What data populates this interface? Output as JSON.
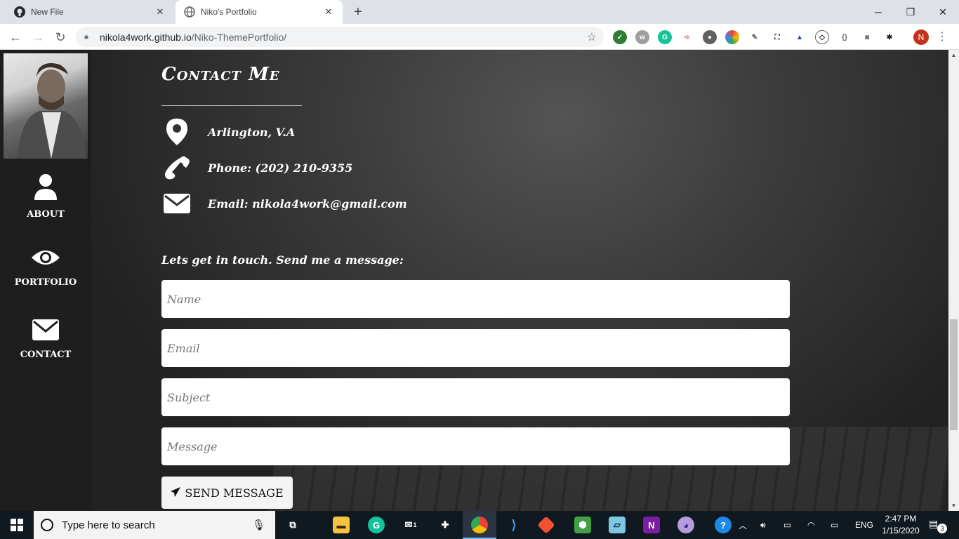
{
  "browser": {
    "tabs": [
      {
        "title": "New File",
        "icon": "github-icon"
      },
      {
        "title": "Niko's Portfolio",
        "icon": "globe-icon"
      }
    ],
    "new_tab": "+",
    "url_host": "nikola4work.github.io",
    "url_path": "/Niko-ThemePortfolio/",
    "profile_initial": "N",
    "extensions": [
      "check-icon",
      "w-icon",
      "grammarly-icon",
      "pointer-icon",
      "circle-icon",
      "color-wheel-icon",
      "eyedropper-icon",
      "screenshot-icon",
      "triangle-icon",
      "code-icon",
      "bracket-icon",
      "camera-icon",
      "bug-icon"
    ]
  },
  "sidebar": {
    "items": [
      {
        "label": "ABOUT",
        "icon": "user-icon"
      },
      {
        "label": "PORTFOLIO",
        "icon": "eye-icon"
      },
      {
        "label": "CONTACT",
        "icon": "envelope-icon"
      }
    ]
  },
  "contact": {
    "heading": "Contact Me",
    "address": "Arlington, V.A",
    "phone": "Phone: (202) 210-9355",
    "email": "Email: nikola4work@gmail.com",
    "lead": "Lets get in touch. Send me a message:",
    "fields": {
      "name_placeholder": "Name",
      "email_placeholder": "Email",
      "subject_placeholder": "Subject",
      "message_placeholder": "Message"
    },
    "send_label": "SEND MESSAGE"
  },
  "taskbar": {
    "search_placeholder": "Type here to search",
    "language": "ENG",
    "time": "2:47 PM",
    "date": "1/15/2020",
    "notification_count": "3",
    "mail_badge": "1"
  },
  "colors": {
    "sidebar_bg": "#1e1e1e",
    "profile": "#c5321c",
    "taskbar_bg": "#101820"
  }
}
